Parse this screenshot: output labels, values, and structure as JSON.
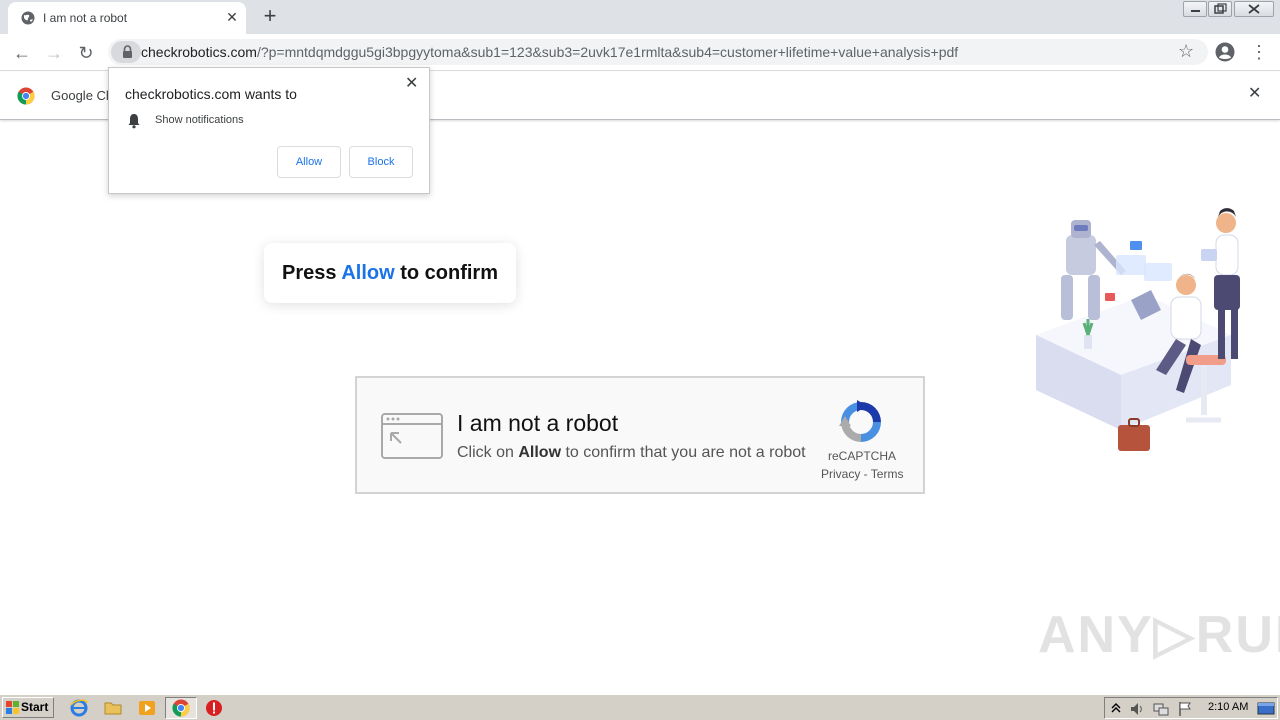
{
  "browser": {
    "tab": {
      "title": "I am not a robot",
      "close": "✕"
    },
    "new_tab": "+",
    "url": {
      "host": "checkrobotics.com",
      "path": "/?p=mntdqmdggu5gi3bpgyytoma&sub1=123&sub3=2uvk17e1rmlta&sub4=customer+lifetime+value+analysis+pdf"
    },
    "nav": {
      "back": "←",
      "forward": "→",
      "reload": "↻",
      "star": "☆",
      "menu": "⋮"
    }
  },
  "infobar": {
    "text": "Google Ch",
    "close": "✕"
  },
  "permission_popup": {
    "title": "checkrobotics.com wants to",
    "permission": "Show notifications",
    "allow_label": "Allow",
    "block_label": "Block",
    "close": "✕"
  },
  "page": {
    "press_prefix": "Press ",
    "press_allow": "Allow",
    "press_suffix": " to confirm",
    "captcha": {
      "title": "I am not a robot",
      "sub_prefix": "Click on ",
      "sub_allow": "Allow",
      "sub_suffix": " to confirm that you are not a robot",
      "recaptcha_label": "reCAPTCHA",
      "links": "Privacy - Terms"
    },
    "watermark": "ANY▷RUN"
  },
  "taskbar": {
    "start_label": "Start",
    "time": "2:10 AM"
  },
  "colors": {
    "accent": "#1a73e8",
    "tab_strip": "#dee1e6",
    "taskbar": "#d4d0c8"
  }
}
